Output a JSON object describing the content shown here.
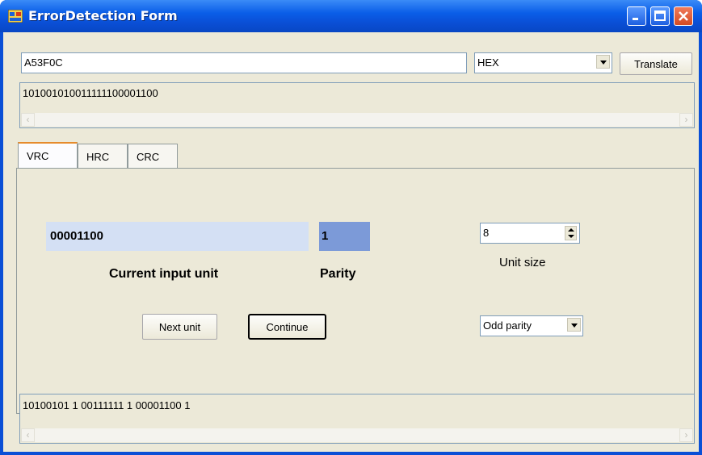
{
  "window": {
    "title": "ErrorDetection Form"
  },
  "input": {
    "value": "A53F0C"
  },
  "format_select": {
    "value": "HEX"
  },
  "translate_button": {
    "label": "Translate"
  },
  "binary_output": {
    "value": "101001010011111100001100"
  },
  "tabs": [
    {
      "label": "VRC",
      "active": true
    },
    {
      "label": "HRC",
      "active": false
    },
    {
      "label": "CRC",
      "active": false
    }
  ],
  "vrc": {
    "current_unit": "00001100",
    "current_unit_label": "Current input unit",
    "parity_value": "1",
    "parity_label": "Parity",
    "unit_size": "8",
    "unit_size_label": "Unit size",
    "parity_mode": "Odd parity",
    "next_unit_label": "Next unit",
    "continue_label": "Continue"
  },
  "result_output": {
    "value": "10100101 1 00111111 1 00001100 1"
  },
  "colors": {
    "titlebar": "#0a4fd6",
    "client_bg": "#ece9d8",
    "unit_highlight": "#d4e0f4",
    "parity_highlight": "#7c9ad8"
  }
}
